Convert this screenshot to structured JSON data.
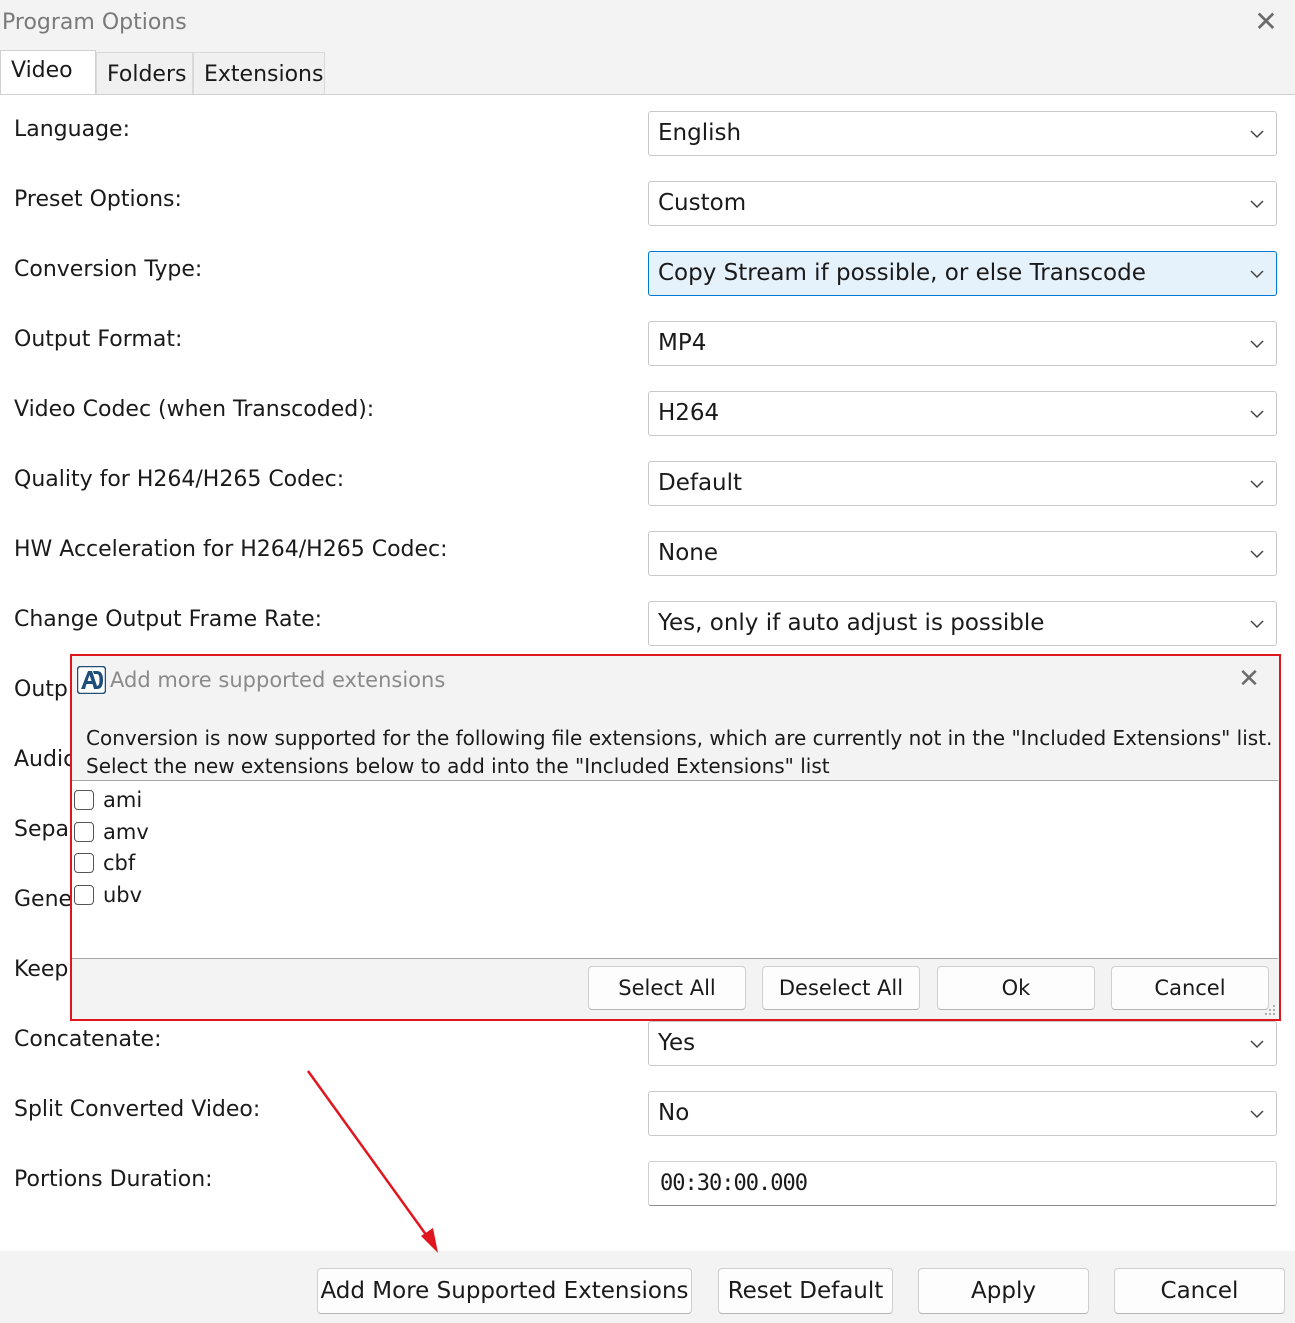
{
  "window": {
    "title": "Program Options",
    "close_symbol": "✕"
  },
  "tabs": [
    {
      "label": "Video",
      "active": true
    },
    {
      "label": "Folders",
      "active": false
    },
    {
      "label": "Extensions",
      "active": false
    }
  ],
  "settings": [
    {
      "label": "Language:",
      "value": "English"
    },
    {
      "label": "Preset Options:",
      "value": "Custom"
    },
    {
      "label": "Conversion Type:",
      "value": "Copy Stream if possible, or else Transcode",
      "focused": true
    },
    {
      "label": "Output Format:",
      "value": "MP4"
    },
    {
      "label": "Video Codec (when Transcoded):",
      "value": "H264"
    },
    {
      "label": "Quality for H264/H265 Codec:",
      "value": "Default"
    },
    {
      "label": "HW Acceleration for H264/H265 Codec:",
      "value": "None"
    },
    {
      "label": "Change Output Frame Rate:",
      "value": "Yes, only if auto adjust is possible"
    },
    {
      "label": "Outp"
    },
    {
      "label": "Audic"
    },
    {
      "label": "Separ"
    },
    {
      "label": "Gene"
    },
    {
      "label": "Keep"
    },
    {
      "label": "Concatenate:",
      "value": "Yes"
    },
    {
      "label": "Split Converted Video:",
      "value": "No"
    },
    {
      "label": "Portions Duration:",
      "value": "00:30:00.000"
    }
  ],
  "footer_buttons": {
    "add_more": "Add More Supported Extensions",
    "reset": "Reset Default",
    "apply": "Apply",
    "cancel": "Cancel"
  },
  "dialog": {
    "title": "Add more supported extensions",
    "close_symbol": "✕",
    "message_line1": "Conversion is now supported for the following file extensions, which are currently not in the \"Included Extensions\" list.",
    "message_line2": "Select the new extensions below to add into the \"Included Extensions\" list",
    "extensions": [
      {
        "label": "ami",
        "checked": false
      },
      {
        "label": "amv",
        "checked": false
      },
      {
        "label": "cbf",
        "checked": false
      },
      {
        "label": "ubv",
        "checked": false
      }
    ],
    "buttons": {
      "select_all": "Select All",
      "deselect_all": "Deselect All",
      "ok": "Ok",
      "cancel": "Cancel"
    },
    "highlight_color": "#e0161f"
  },
  "colors": {
    "focus_accent": "#0078d4",
    "annotation_red": "#e0161f"
  }
}
